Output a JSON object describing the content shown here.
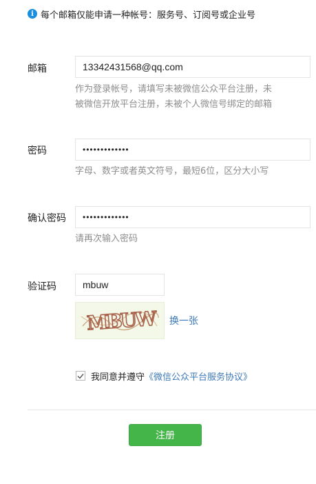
{
  "notice": {
    "icon": "info-icon",
    "icon_glyph": "i",
    "text": "每个邮箱仅能申请一种帐号：服务号、订阅号或企业号"
  },
  "form": {
    "email": {
      "label": "邮箱",
      "value": "13342431568@qq.com",
      "hint_line1": "作为登录帐号，请填写未被微信公众平台注册，未",
      "hint_line2": "被微信开放平台注册，未被个人微信号绑定的邮箱"
    },
    "password": {
      "label": "密码",
      "value": "•••••••••••••",
      "hint": "字母、数字或者英文符号，最短6位，区分大小写"
    },
    "confirm_password": {
      "label": "确认密码",
      "value": "•••••••••••••",
      "hint": "请再次输入密码"
    },
    "captcha": {
      "label": "验证码",
      "value": "mbuw",
      "image_text": "MBUW",
      "refresh_label": "换一张"
    },
    "agreement": {
      "checked": true,
      "text": "我同意并遵守",
      "link": "《微信公众平台服务协议》"
    },
    "submit_label": "注册"
  },
  "colors": {
    "accent_green": "#44b549",
    "link_blue": "#3d79b8",
    "info_blue": "#1a8fe0",
    "hint_gray": "#8d8d8d"
  }
}
